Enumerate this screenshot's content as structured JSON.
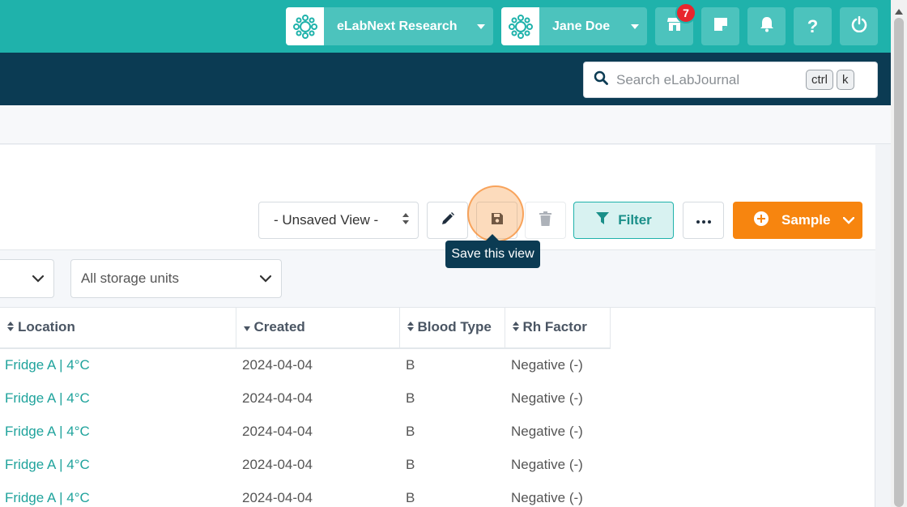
{
  "header": {
    "org": {
      "label": "eLabNext Research"
    },
    "user": {
      "label": "Jane Doe"
    },
    "marketplace_badge": "7",
    "icons": [
      "marketplace-icon",
      "notes-icon",
      "bell-icon",
      "help-icon",
      "power-icon"
    ]
  },
  "search": {
    "placeholder": "Search eLabJournal",
    "kbd_ctrl": "ctrl",
    "kbd_k": "k"
  },
  "toolbar": {
    "view_select": "- Unsaved View -",
    "filter_label": "Filter",
    "sample_label": "Sample",
    "save_tooltip": "Save this view"
  },
  "filters": {
    "storage_units": "All storage units"
  },
  "table": {
    "columns": [
      {
        "label": "Location",
        "sort": "both"
      },
      {
        "label": "Created",
        "sort": "desc"
      },
      {
        "label": "Blood Type",
        "sort": "both"
      },
      {
        "label": "Rh Factor",
        "sort": "both"
      }
    ],
    "rows": [
      {
        "location": "Fridge A | 4°C",
        "created": "2024-04-04",
        "blood_type": "B",
        "rh_factor": "Negative (-)"
      },
      {
        "location": "Fridge A | 4°C",
        "created": "2024-04-04",
        "blood_type": "B",
        "rh_factor": "Negative (-)"
      },
      {
        "location": "Fridge A | 4°C",
        "created": "2024-04-04",
        "blood_type": "B",
        "rh_factor": "Negative (-)"
      },
      {
        "location": "Fridge A | 4°C",
        "created": "2024-04-04",
        "blood_type": "B",
        "rh_factor": "Negative (-)"
      },
      {
        "location": "Fridge A | 4°C",
        "created": "2024-04-04",
        "blood_type": "B",
        "rh_factor": "Negative (-)"
      }
    ]
  },
  "colors": {
    "teal": "#1fb2ab",
    "navy": "#0b3b53",
    "orange": "#f7850f"
  }
}
